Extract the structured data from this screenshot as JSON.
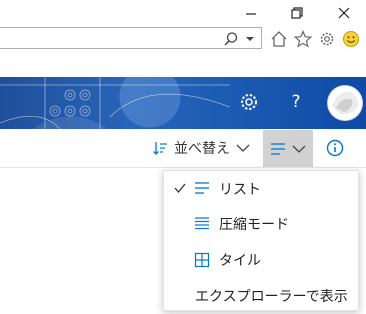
{
  "window": {
    "controls": [
      "minimize-icon",
      "restore-icon",
      "close-icon"
    ]
  },
  "browser": {
    "address_value": "",
    "toolbar_icons": [
      "home-icon",
      "favorites-star-icon",
      "settings-gear-icon",
      "feedback-smiley-icon"
    ]
  },
  "header": {
    "icons": [
      "settings-gear-icon",
      "help-icon",
      "avatar"
    ],
    "help_label": "?",
    "colors": {
      "banner": "#1f5ab0",
      "accent": "#0078d4"
    }
  },
  "command_bar": {
    "sort_label": "並べ替え",
    "view_icon": "list-view-icon",
    "info_icon": "info-icon"
  },
  "view_menu": {
    "items": [
      {
        "label": "リスト",
        "icon": "list-icon",
        "checked": true
      },
      {
        "label": "圧縮モード",
        "icon": "compact-list-icon",
        "checked": false
      },
      {
        "label": "タイル",
        "icon": "tiles-icon",
        "checked": false
      },
      {
        "label": "エクスプローラーで表示",
        "icon": "",
        "checked": false
      }
    ]
  }
}
